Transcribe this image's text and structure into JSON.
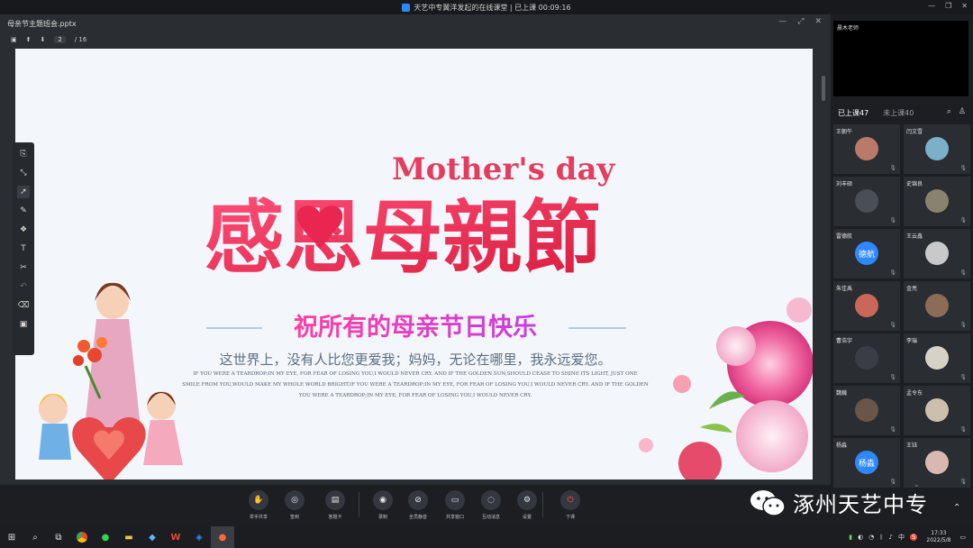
{
  "window": {
    "title": "天艺中专翼洋发起的在线课堂 | 已上课 00:09:16",
    "controls": [
      "—",
      "❐",
      "✕"
    ]
  },
  "document": {
    "filename": "母亲节主题班会.pptx",
    "page_current": "2",
    "page_total": "/ 16",
    "controls": [
      "—",
      "⤢",
      "✕"
    ]
  },
  "slide": {
    "headline_cn": "感恩母親節",
    "headline_en": "Mother's day",
    "subtitle": "祝所有的母亲节日快乐",
    "tagline": "这世界上，没有人比您更爱我；妈妈，无论在哪里，我永远爱您。",
    "body_lines": [
      "IF YOU WERE A TEARDROP;IN MY EYE, FOR FEAR OF LOSING YOU,I WOULD NEVER CRY.  AND IF THE GOLDEN SUN,SHOULD CEASE TO SHINE ITS LIGHT, JUST ONE",
      "SMILE FROM YOU,WOULD MAKE MY WHOLE WORLD BRIGHT.IF YOU WERE A TEARDROP;IN MY EYE, FOR FEAR OF LOSING YOU,I WOULD NEVER CRY.  AND IF THE GOLDEN",
      "YOU WERE A TEARDROP;IN MY EYE, FOR FEAR OF LOSING YOU,I WOULD NEVER CRY."
    ]
  },
  "teacher": {
    "label": "晨木老师"
  },
  "attendance": {
    "present": "已上课47",
    "absent": "未上课40"
  },
  "students": [
    {
      "name": "王朝午",
      "avatar": "photo",
      "color": "#b97a6a"
    },
    {
      "name": "闫文雪",
      "avatar": "photo",
      "color": "#7ab0c8"
    },
    {
      "name": "刘丰硕",
      "avatar": "photo",
      "color": "#4a4f55"
    },
    {
      "name": "史锦良",
      "avatar": "photo",
      "color": "#8a8270"
    },
    {
      "name": "雷德航",
      "avatar": "德航",
      "color": "#2f88ff"
    },
    {
      "name": "王云鑫",
      "avatar": "photo",
      "color": "#c9c9c9"
    },
    {
      "name": "朱佳禹",
      "avatar": "photo",
      "color": "#c8675a"
    },
    {
      "name": "金亮",
      "avatar": "photo",
      "color": "#8c6c58"
    },
    {
      "name": "曹浩宇",
      "avatar": "photo",
      "color": "#3a3d44"
    },
    {
      "name": "李瑞",
      "avatar": "photo",
      "color": "#d7d2c7"
    },
    {
      "name": "魏巍",
      "avatar": "photo",
      "color": "#6a5648"
    },
    {
      "name": "孟令东",
      "avatar": "photo",
      "color": "#cdbfae"
    },
    {
      "name": "杨淼",
      "avatar": "杨淼",
      "color": "#2f88ff"
    },
    {
      "name": "王钰",
      "avatar": "photo",
      "color": "#d9b8b2"
    }
  ],
  "bottom_controls": [
    {
      "id": "raise-hand",
      "icon": "✋",
      "label": "举手共享"
    },
    {
      "id": "sign-in",
      "icon": "◎",
      "label": "签到"
    },
    {
      "id": "answer-card",
      "icon": "▤",
      "label": "答题卡"
    },
    {
      "id": "record",
      "icon": "◉",
      "label": "录制"
    },
    {
      "id": "mute-all",
      "icon": "⊘",
      "label": "全员静音"
    },
    {
      "id": "share-window",
      "icon": "▭",
      "label": "共享窗口"
    },
    {
      "id": "interactive-msg",
      "icon": "◌",
      "label": "互动消息"
    },
    {
      "id": "settings",
      "icon": "⚙",
      "label": "设置"
    },
    {
      "id": "exit-class",
      "icon": "⏻",
      "label": "下课"
    }
  ],
  "watermark": {
    "text": "涿州天艺中专"
  },
  "taskbar": {
    "time": "17:33",
    "date": "2022/5/8",
    "ime": "中",
    "s_badge": "S"
  }
}
